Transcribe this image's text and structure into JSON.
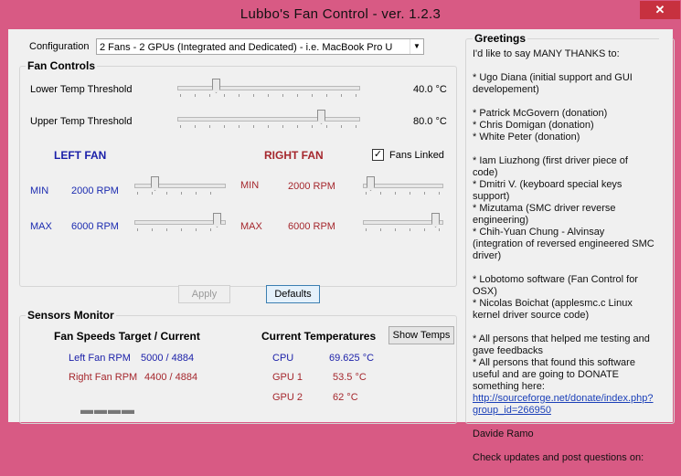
{
  "window": {
    "title": "Lubbo's Fan Control  -  ver. 1.2.3",
    "close_label": "✕"
  },
  "configuration": {
    "label": "Configuration",
    "selected": "2 Fans - 2 GPUs (Integrated and Dedicated) - i.e. MacBook Pro U"
  },
  "fan_controls": {
    "title": "Fan Controls",
    "lower_threshold_label": "Lower Temp Threshold",
    "lower_threshold_value": "40.0 °C",
    "upper_threshold_label": "Upper Temp Threshold",
    "upper_threshold_value": "80.0 °C",
    "left_fan_label": "LEFT FAN",
    "right_fan_label": "RIGHT FAN",
    "fans_linked_label": "Fans Linked",
    "fans_linked_checked": "✓",
    "left_min_label": "MIN",
    "left_min_value": "2000 RPM",
    "left_max_label": "MAX",
    "left_max_value": "6000 RPM",
    "right_min_label": "MIN",
    "right_min_value": "2000 RPM",
    "right_max_label": "MAX",
    "right_max_value": "6000 RPM",
    "lower_slider_level": 0.2,
    "upper_slider_level": 0.8,
    "left_min_slider_level": 0.2,
    "left_max_slider_level": 0.95,
    "right_min_slider_level": 0.05,
    "right_max_slider_level": 0.95
  },
  "actions": {
    "apply_label": "Apply",
    "defaults_label": "Defaults"
  },
  "sensors_monitor": {
    "title": "Sensors Monitor",
    "fan_speeds_header": "Fan Speeds Target / Current",
    "left_fan_label": "Left  Fan RPM",
    "left_fan_value": "5000 / 4884",
    "right_fan_label": "Right Fan RPM",
    "right_fan_value": "4400 / 4884",
    "dashes": "▬▬▬▬",
    "temps_header": "Current Temperatures",
    "show_temps_label": "Show Temps",
    "cpu_label": "CPU",
    "cpu_value": "69.625 °C",
    "gpu1_label": "GPU 1",
    "gpu1_value": "53.5 °C",
    "gpu2_label": "GPU 2",
    "gpu2_value": "62 °C"
  },
  "greetings": {
    "title": "Greetings",
    "intro": "I'd like to say MANY THANKS to:",
    "p1": "* Ugo Diana (initial support and GUI developement)",
    "p2a": "* Patrick McGovern (donation)",
    "p2b": "* Chris Domigan (donation)",
    "p2c": "* White Peter (donation)",
    "p3a": "* Iam Liuzhong (first driver piece of code)",
    "p3b": "* Dmitri V. (keyboard special keys support)",
    "p3c": "* Mizutama (SMC driver reverse engineering)",
    "p3d": "* Chih-Yuan Chung - Alvinsay (integration of reversed engineered SMC driver)",
    "p4a": "* Lobotomo software (Fan Control for OSX)",
    "p4b": "* Nicolas Boichat (applesmc.c Linux kernel driver source code)",
    "p5a": "* All persons that helped me testing and gave feedbacks",
    "p5b": "* All persons that found this software useful and are going to DONATE something here:",
    "link": "http://sourceforge.net/donate/index.php?group_id=266950",
    "author": "Davide Ramo",
    "footer": "Check updates and post questions on:"
  }
}
